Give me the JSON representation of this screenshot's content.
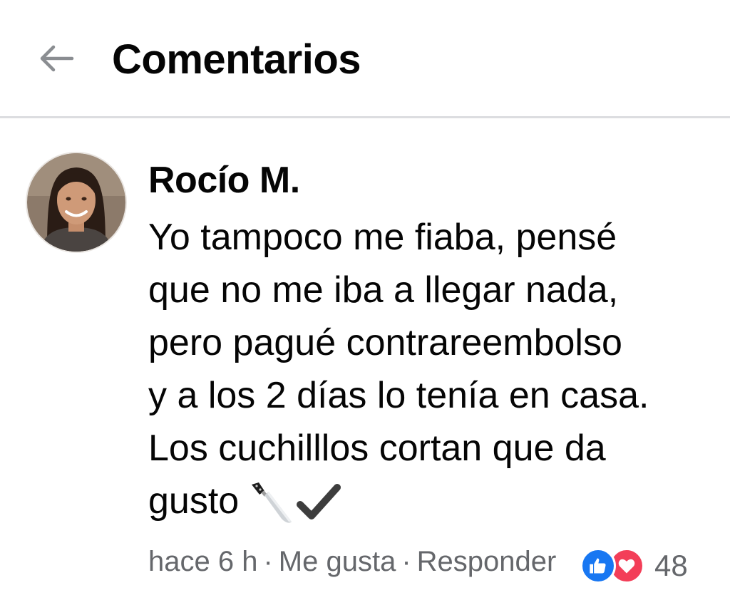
{
  "header": {
    "title": "Comentarios",
    "back_icon": "arrow-left-icon"
  },
  "comment": {
    "author": "Rocío M.",
    "text_lines": [
      "Yo tampoco me fiaba, pensé",
      "que no me iba a llegar nada,",
      "pero pagué contrareembolso",
      "y a los 2 días lo tenía en casa.",
      "Los cuchilllos cortan que da",
      "gusto"
    ],
    "emoji": [
      "knife-icon",
      "check-mark-icon"
    ],
    "time": "hace 6 h",
    "like_label": "Me gusta",
    "reply_label": "Responder",
    "separator": "·",
    "reaction_icons": [
      "like-icon",
      "love-icon"
    ],
    "reaction_count": "48"
  },
  "colors": {
    "text": "#050505",
    "secondary_text": "#65676b",
    "divider": "#dcdde0",
    "like_blue": "#1877f2",
    "love_red": "#f33e58"
  }
}
